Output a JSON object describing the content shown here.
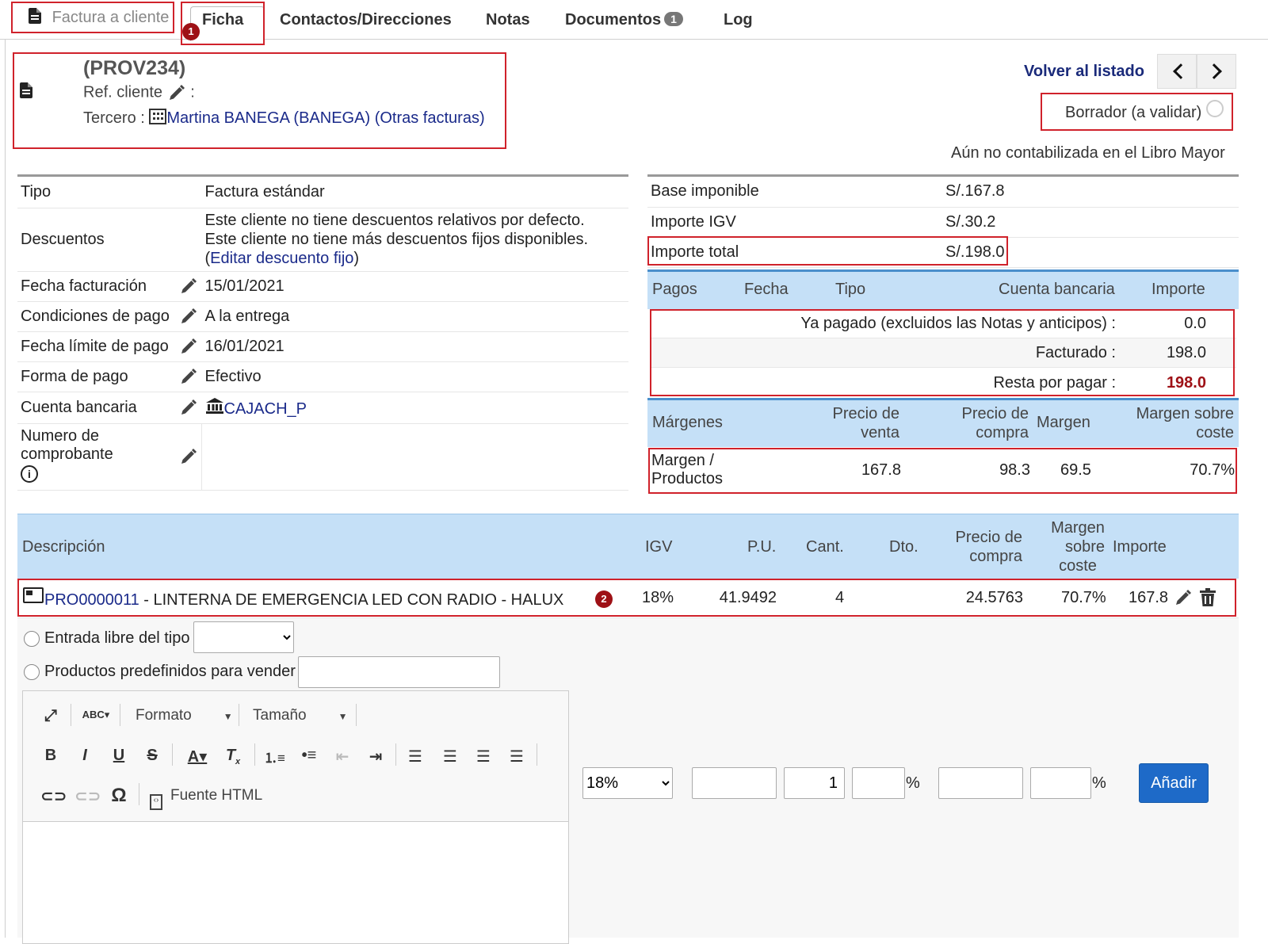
{
  "tabs": [
    {
      "label": "Factura a cliente"
    },
    {
      "label": "Ficha"
    },
    {
      "label": "Contactos/Direcciones"
    },
    {
      "label": "Notas"
    },
    {
      "label": "Documentos",
      "badge": "1"
    },
    {
      "label": "Log"
    }
  ],
  "markers": {
    "one": "1",
    "two": "2"
  },
  "header": {
    "ref": "(PROV234)",
    "ref_client_label": "Ref. cliente",
    "colon": ":",
    "tercero_label": "Tercero :",
    "tercero_name": "Martina BANEGA (BANEGA)",
    "otras_facturas": "(Otras facturas)",
    "volver": "Volver al listado",
    "status": "Borrador (a validar)",
    "ledger_note": "Aún no contabilizada en el Libro Mayor"
  },
  "details": {
    "tipo_label": "Tipo",
    "tipo_value": "Factura estándar",
    "desc_label": "Descuentos",
    "desc_line1": "Este cliente no tiene descuentos relativos por defecto.",
    "desc_line2": "Este cliente no tiene más descuentos fijos disponibles.",
    "desc_link": "Editar descuento fijo",
    "fecha_label": "Fecha facturación",
    "fecha_value": "15/01/2021",
    "cond_label": "Condiciones de pago",
    "cond_value": "A la entrega",
    "limite_label": "Fecha límite de pago",
    "limite_value": "16/01/2021",
    "forma_label": "Forma de pago",
    "forma_value": "Efectivo",
    "cuenta_label": "Cuenta bancaria",
    "cuenta_value": "CAJACH_P",
    "numero_label_1": "Numero de",
    "numero_label_2": "comprobante"
  },
  "totals": {
    "base_label": "Base imponible",
    "base_value": "S/.167.8",
    "igv_label": "Importe IGV",
    "igv_value": "S/.30.2",
    "total_label": "Importe total",
    "total_value": "S/.198.0"
  },
  "payments": {
    "headers": [
      "Pagos",
      "Fecha",
      "Tipo",
      "Cuenta bancaria",
      "Importe"
    ],
    "paid_label": "Ya pagado (excluidos las Notas y anticipos) :",
    "paid_value": "0.0",
    "billed_label": "Facturado :",
    "billed_value": "198.0",
    "remaining_label": "Resta por pagar :",
    "remaining_value": "198.0",
    "remaining_color": "#9e1116"
  },
  "margins": {
    "h_margenes": "Márgenes",
    "h_pv_1": "Precio de",
    "h_pv_2": "venta",
    "h_pc_1": "Precio de",
    "h_pc_2": "compra",
    "h_margen": "Margen",
    "h_ms_1": "Margen sobre",
    "h_ms_2": "coste",
    "row_label_1": "Margen /",
    "row_label_2": "Productos",
    "pv": "167.8",
    "pc": "98.3",
    "margen": "69.5",
    "ms": "70.7%"
  },
  "lines": {
    "h_desc": "Descripción",
    "h_igv": "IGV",
    "h_pu": "P.U.",
    "h_cant": "Cant.",
    "h_dto": "Dto.",
    "h_pc_1": "Precio de",
    "h_pc_2": "compra",
    "h_ms_1": "Margen",
    "h_ms_2": "sobre",
    "h_ms_3": "coste",
    "h_importe": "Importe",
    "row": {
      "ref": "PRO0000011",
      "desc": " - LINTERNA DE EMERGENCIA LED CON RADIO - HALUX",
      "igv": "18%",
      "pu": "41.9492",
      "cant": "4",
      "pc": "24.5763",
      "ms": "70.7%",
      "importe": "167.8"
    }
  },
  "addline": {
    "free_label": "Entrada libre del tipo",
    "predef_label": "Productos predefinidos para vender",
    "formato": "Formato",
    "tamano": "Tamaño",
    "fuente_html": "Fuente HTML",
    "vat_selected": "18%",
    "qty": "1",
    "pct": "%",
    "add_button": "Añadir"
  },
  "colors": {
    "accent_blue": "#1e6ac8",
    "header_blue": "#c5e0f7",
    "highlight_red": "#d0222b"
  }
}
